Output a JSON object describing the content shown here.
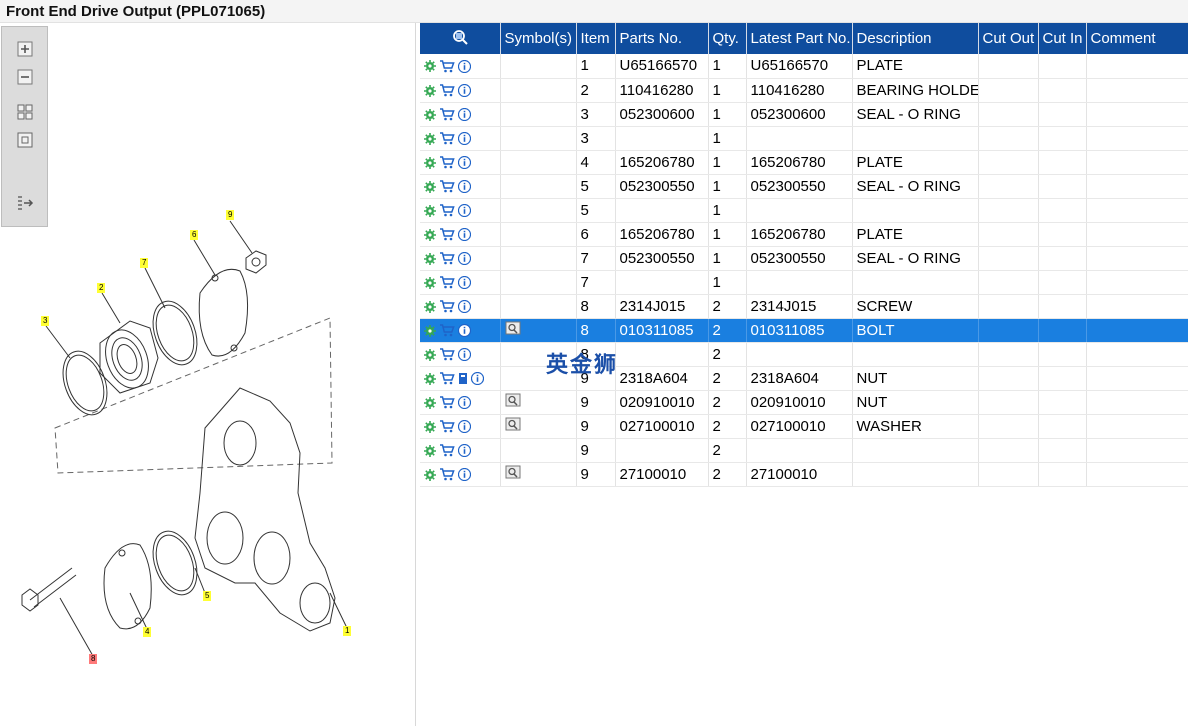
{
  "window": {
    "title": "Front End Drive Output (PPL071065)"
  },
  "diagram": {
    "callouts": [
      "9",
      "6",
      "7",
      "2",
      "3",
      "5",
      "4",
      "1",
      "8"
    ]
  },
  "table": {
    "columns": [
      "Symbol(s)",
      "Item",
      "Parts No.",
      "Qty.",
      "Latest Part No.",
      "Description",
      "Cut Out",
      "Cut In",
      "Comment"
    ],
    "rows": [
      {
        "item": "1",
        "part": "U65166570",
        "qty": "1",
        "latest": "U65166570",
        "desc": "PLATE"
      },
      {
        "item": "2",
        "part": "110416280",
        "qty": "1",
        "latest": "110416280",
        "desc": "BEARING HOLDER"
      },
      {
        "item": "3",
        "part": "052300600",
        "qty": "1",
        "latest": "052300600",
        "desc": "SEAL - O RING"
      },
      {
        "item": "3",
        "part": "",
        "qty": "1",
        "latest": "",
        "desc": ""
      },
      {
        "item": "4",
        "part": "165206780",
        "qty": "1",
        "latest": "165206780",
        "desc": "PLATE"
      },
      {
        "item": "5",
        "part": "052300550",
        "qty": "1",
        "latest": "052300550",
        "desc": "SEAL - O RING"
      },
      {
        "item": "5",
        "part": "",
        "qty": "1",
        "latest": "",
        "desc": ""
      },
      {
        "item": "6",
        "part": "165206780",
        "qty": "1",
        "latest": "165206780",
        "desc": "PLATE"
      },
      {
        "item": "7",
        "part": "052300550",
        "qty": "1",
        "latest": "052300550",
        "desc": "SEAL - O RING"
      },
      {
        "item": "7",
        "part": "",
        "qty": "1",
        "latest": "",
        "desc": ""
      },
      {
        "item": "8",
        "part": "2314J015",
        "qty": "2",
        "latest": "2314J015",
        "desc": "SCREW"
      },
      {
        "item": "8",
        "part": "010311085",
        "qty": "2",
        "latest": "010311085",
        "desc": "BOLT"
      },
      {
        "item": "8",
        "part": "",
        "qty": "2",
        "latest": "",
        "desc": ""
      },
      {
        "item": "9",
        "part": "2318A604",
        "qty": "2",
        "latest": "2318A604",
        "desc": "NUT"
      },
      {
        "item": "9",
        "part": "020910010",
        "qty": "2",
        "latest": "020910010",
        "desc": "NUT"
      },
      {
        "item": "9",
        "part": "027100010",
        "qty": "2",
        "latest": "027100010",
        "desc": "WASHER"
      },
      {
        "item": "9",
        "part": "",
        "qty": "2",
        "latest": "",
        "desc": ""
      },
      {
        "item": "9",
        "part": "27100010",
        "qty": "2",
        "latest": "27100010",
        "desc": ""
      }
    ]
  },
  "watermark": "英金狮",
  "colors": {
    "header": "#0f4d9e",
    "selected": "#1a7fe0",
    "gear": "#34a853"
  }
}
